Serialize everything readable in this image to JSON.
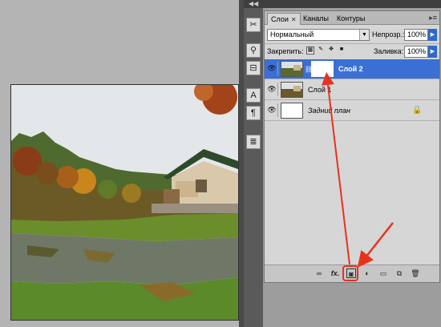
{
  "tabs": [
    {
      "label": "Слои",
      "active": true
    },
    {
      "label": "Каналы",
      "active": false
    },
    {
      "label": "Контуры",
      "active": false
    }
  ],
  "blend_mode": "Нормальный",
  "opacity_label": "Непрозр.:",
  "opacity_value": "100%",
  "lock_label": "Закрепить:",
  "fill_label": "Заливка:",
  "fill_value": "100%",
  "layers": [
    {
      "name": "Слой 2",
      "selected": true,
      "has_mask": true
    },
    {
      "name": "Слой 1",
      "selected": false,
      "has_mask": false
    },
    {
      "name": "Задний план",
      "selected": false,
      "locked": true
    }
  ],
  "bottom_icons": [
    "link-icon",
    "fx-icon",
    "add-mask-icon",
    "adjustment-icon",
    "group-icon",
    "new-layer-icon",
    "trash-icon"
  ],
  "fx_label": "fx.",
  "annotation_color": "#e8321e",
  "accent_color": "#3b6fd4",
  "tool_icons": [
    "tools-icon",
    "brush-icon",
    "stamp-icon",
    "text-icon",
    "paragraph-icon",
    "document-icon"
  ]
}
